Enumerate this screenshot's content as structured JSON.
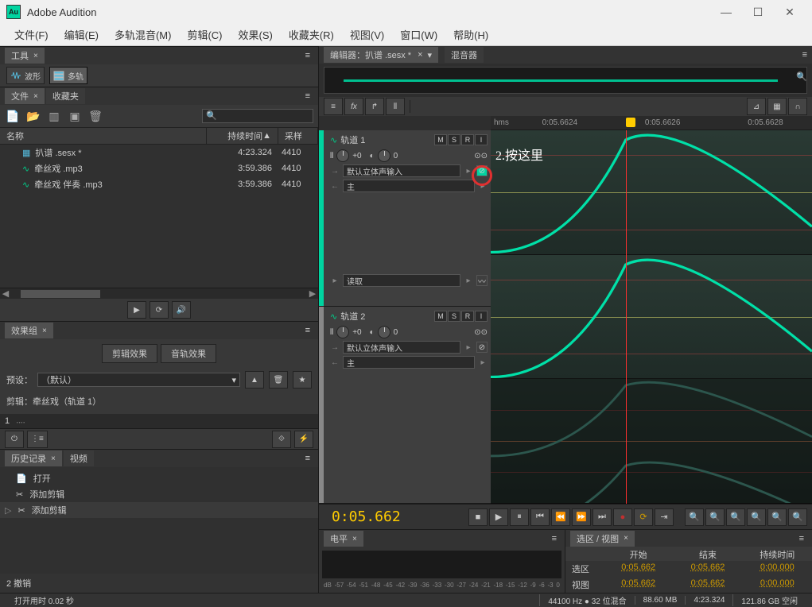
{
  "app_title": "Adobe Audition",
  "menu": [
    "文件(F)",
    "编辑(E)",
    "多轨混音(M)",
    "剪辑(C)",
    "效果(S)",
    "收藏夹(R)",
    "视图(V)",
    "窗口(W)",
    "帮助(H)"
  ],
  "tools_panel": {
    "title": "工具",
    "mode_wave": "波形",
    "mode_multi": "多轨"
  },
  "files_panel": {
    "title": "文件",
    "fav_tab": "收藏夹",
    "cols": {
      "name": "名称",
      "dur": "持续时间",
      "sr": "采样"
    },
    "items": [
      {
        "icon": "session",
        "name": "扒谱 .sesx *",
        "dur": "4:23.324",
        "sr": "4410"
      },
      {
        "icon": "audio",
        "name": "牵丝戏 .mp3",
        "dur": "3:59.386",
        "sr": "4410"
      },
      {
        "icon": "audio",
        "name": "牵丝戏 伴奏 .mp3",
        "dur": "3:59.386",
        "sr": "4410"
      }
    ]
  },
  "fx_panel": {
    "title": "效果组",
    "tab_clip": "剪辑效果",
    "tab_track": "音轨效果",
    "preset_lbl": "预设：",
    "preset_val": "（默认）",
    "edit_lbl": "剪辑：牵丝戏（轨道 1）",
    "row1": "1"
  },
  "history_panel": {
    "title": "历史记录",
    "tab2": "视频",
    "items": [
      "打开",
      "添加剪辑",
      "添加剪辑"
    ],
    "undo": "2 撤销"
  },
  "editor": {
    "tab": "编辑器：扒谱 .sesx *",
    "tab2": "混音器",
    "ruler": {
      "unit": "hms",
      "t1": "0:05.6624",
      "t2": "0:05.6626",
      "t3": "0:05.6628"
    },
    "annotation": "2.按这里",
    "timecode": "0:05.662",
    "track1": {
      "name": "轨道 1",
      "vol": "+0",
      "pan": "0",
      "in": "默认立体声输入",
      "out": "主",
      "read": "读取"
    },
    "track2": {
      "name": "轨道 2",
      "vol": "+0",
      "pan": "0",
      "in": "默认立体声输入",
      "out": "主"
    }
  },
  "levels": {
    "title": "电平",
    "scale": [
      "dB",
      "-57",
      "-54",
      "-51",
      "-48",
      "-45",
      "-42",
      "-39",
      "-36",
      "-33",
      "-30",
      "-27",
      "-24",
      "-21",
      "-18",
      "-15",
      "-12",
      "-9",
      "-6",
      "-3",
      "0"
    ]
  },
  "selview": {
    "title": "选区 / 视图",
    "cols": {
      "start": "开始",
      "end": "结束",
      "dur": "持续时间"
    },
    "sel": {
      "lbl": "选区",
      "start": "0:05.662",
      "end": "0:05.662",
      "dur": "0:00.000"
    },
    "view": {
      "lbl": "视图",
      "start": "0:05.662",
      "end": "0:05.662",
      "dur": "0:00.000"
    }
  },
  "status": {
    "open": "打开用时 0.02 秒",
    "hz": "44100 Hz ● 32 位混合",
    "mb": "88.60 MB",
    "dur": "4:23.324",
    "disk": "121.86 GB 空闲"
  }
}
